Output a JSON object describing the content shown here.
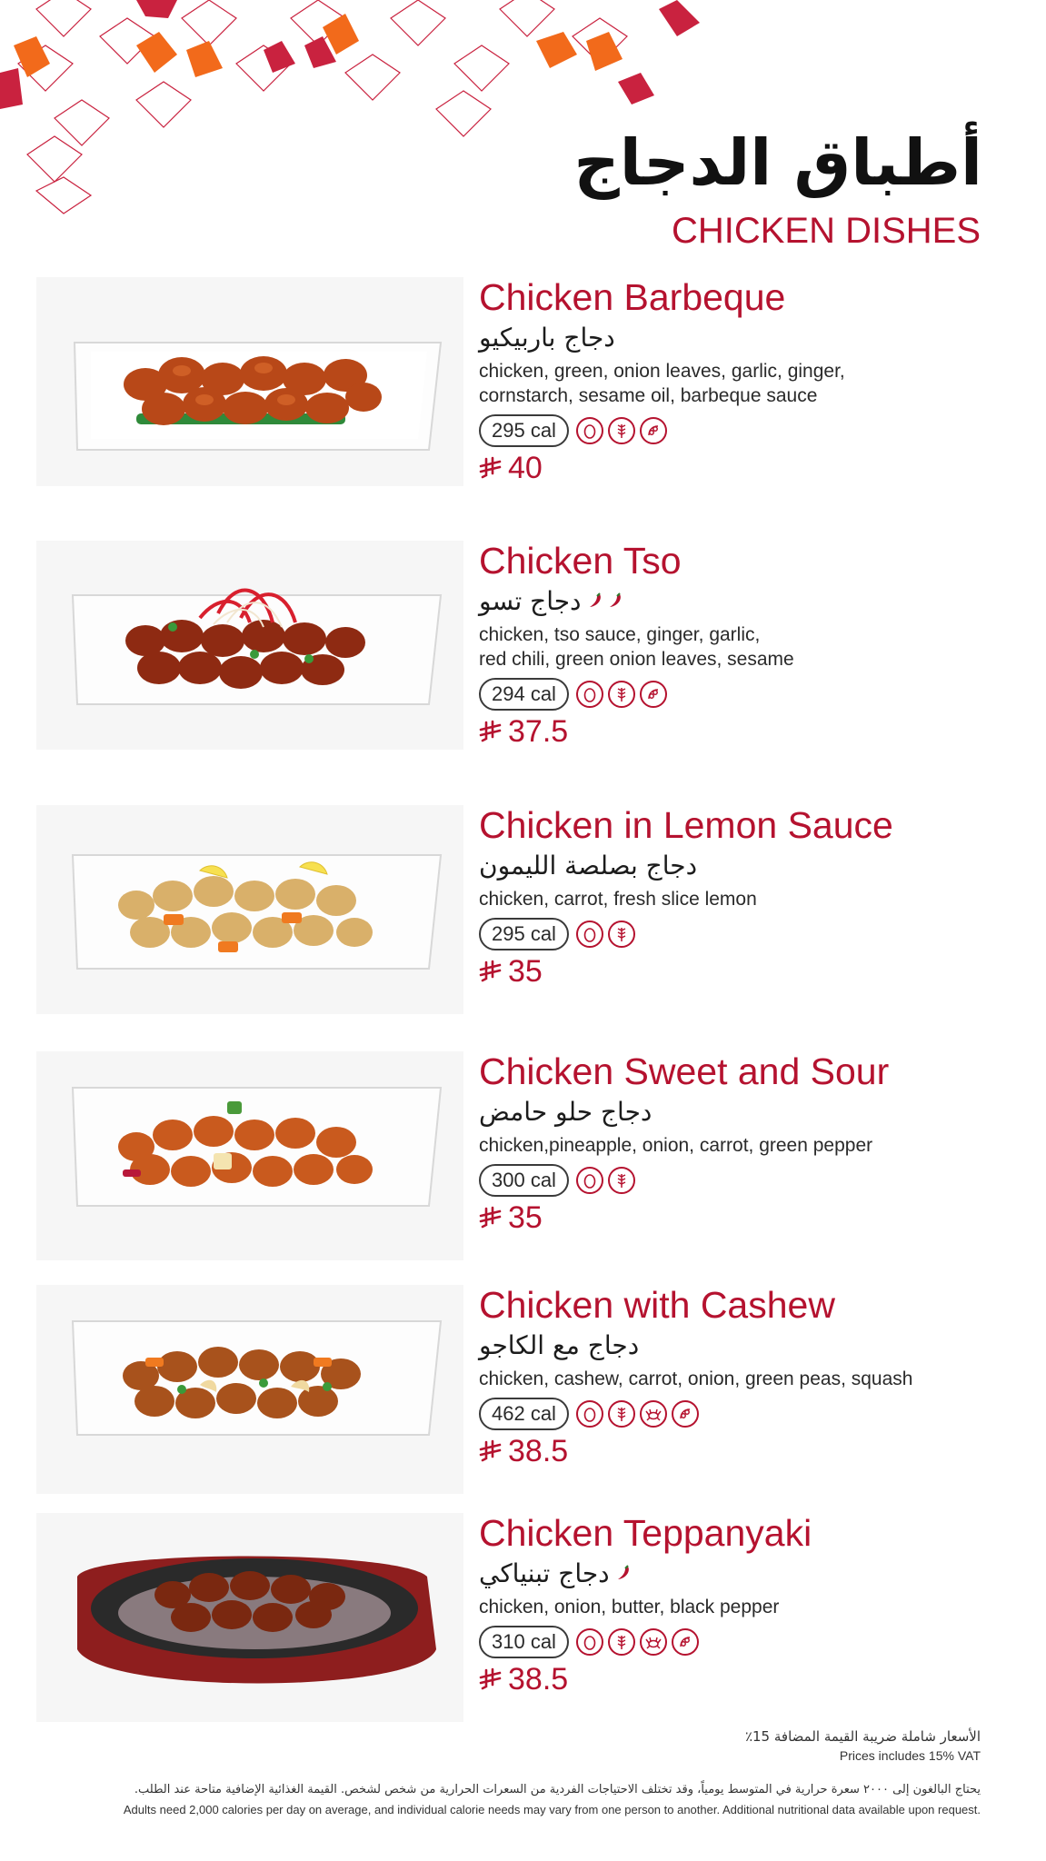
{
  "colors": {
    "accent": "#b5122f",
    "orange": "#f26a1b",
    "text": "#1c1c1c"
  },
  "header": {
    "title_ar": "أطباق الدجاج",
    "title_en": "CHICKEN DISHES"
  },
  "items": [
    {
      "name_en": "Chicken Barbeque",
      "name_ar": "دجاج باربيكيو",
      "spicy": 0,
      "ingredients_line1": "chicken, green, onion leaves, garlic, ginger,",
      "ingredients_line2": "cornstarch, sesame oil, barbeque sauce",
      "calories": "295 cal",
      "allergens": [
        "egg-icon",
        "wheat-icon",
        "soy-icon"
      ],
      "price": "40",
      "photo": "chicken-barbeque-photo"
    },
    {
      "name_en": "Chicken Tso",
      "name_ar": "دجاج تسو",
      "spicy": 2,
      "ingredients_line1": "chicken, tso sauce, ginger, garlic,",
      "ingredients_line2": "red chili, green onion leaves, sesame",
      "calories": "294 cal",
      "allergens": [
        "egg-icon",
        "wheat-icon",
        "soy-icon"
      ],
      "price": "37.5",
      "photo": "chicken-tso-photo"
    },
    {
      "name_en": "Chicken in Lemon Sauce",
      "name_ar": "دجاج بصلصة الليمون",
      "spicy": 0,
      "ingredients_line1": "chicken, carrot, fresh slice lemon",
      "ingredients_line2": "",
      "calories": "295 cal",
      "allergens": [
        "egg-icon",
        "wheat-icon"
      ],
      "price": "35",
      "photo": "chicken-lemon-photo"
    },
    {
      "name_en": "Chicken Sweet and Sour",
      "name_ar": "دجاج حلو حامض",
      "spicy": 0,
      "ingredients_line1": "chicken,pineapple, onion, carrot, green pepper",
      "ingredients_line2": "",
      "calories": "300 cal",
      "allergens": [
        "egg-icon",
        "wheat-icon"
      ],
      "price": "35",
      "photo": "chicken-sweet-sour-photo"
    },
    {
      "name_en": "Chicken with Cashew",
      "name_ar": "دجاج مع الكاجو",
      "spicy": 0,
      "ingredients_line1": "chicken, cashew, carrot, onion, green peas, squash",
      "ingredients_line2": "",
      "calories": "462 cal",
      "allergens": [
        "egg-icon",
        "wheat-icon",
        "shellfish-icon",
        "soy-icon"
      ],
      "price": "38.5",
      "photo": "chicken-cashew-photo"
    },
    {
      "name_en": "Chicken Teppanyaki",
      "name_ar": "دجاج تبنياكي",
      "spicy": 1,
      "ingredients_line1": "chicken, onion, butter, black pepper",
      "ingredients_line2": "",
      "calories": "310 cal",
      "allergens": [
        "egg-icon",
        "wheat-icon",
        "shellfish-icon",
        "soy-icon"
      ],
      "price": "38.5",
      "photo": "chicken-teppanyaki-photo"
    }
  ],
  "footer": {
    "vat_ar": "الأسعار شاملة ضريبة القيمة المضافة 15٪",
    "vat_en": "Prices includes 15% VAT",
    "note_ar": "يحتاج البالغون إلى ٢٠٠٠ سعرة حرارية في المتوسط يومياً، وقد تختلف الاحتياجات الفردية من السعرات الحرارية من شخص لشخص. القيمة الغذائية الإضافية متاحة عند الطلب.",
    "note_en": "Adults need 2,000 calories per day on average, and individual calorie needs may vary from one person to another. Additional nutritional data available upon request."
  }
}
